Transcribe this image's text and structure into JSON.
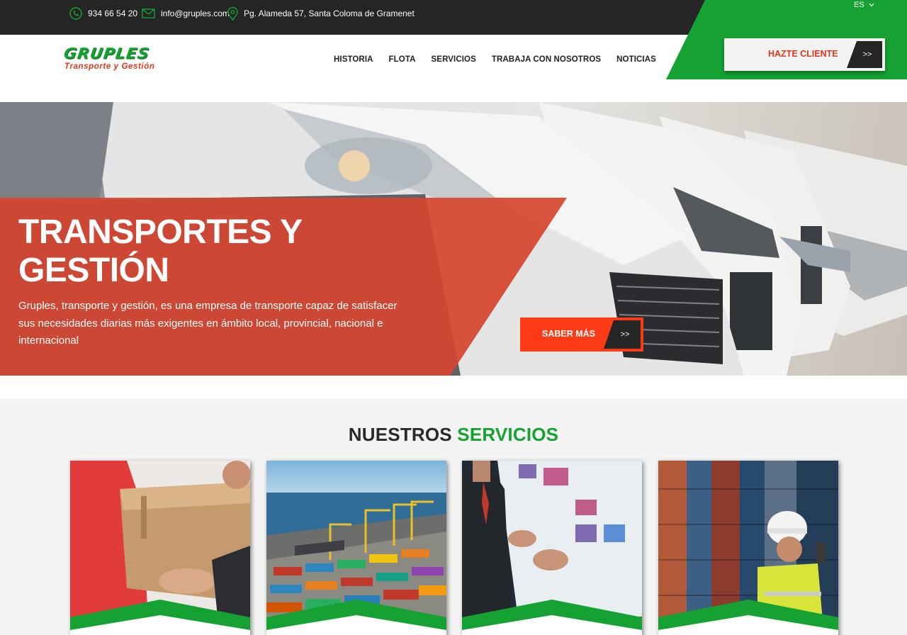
{
  "topbar": {
    "phone": "934 66 54 20",
    "email": "info@gruples.com",
    "address": "Pg. Alameda 57, Santa Coloma de Gramenet",
    "language": "ES"
  },
  "brand": {
    "name": "GRUPLES",
    "tagline": "Transporte y Gestión"
  },
  "nav": {
    "items": [
      "HISTORIA",
      "FLOTA",
      "SERVICIOS",
      "TRABAJA CON NOSOTROS",
      "NOTICIAS"
    ]
  },
  "cta": {
    "label": "HAZTE CLIENTE",
    "arrow": ">>"
  },
  "hero": {
    "title_line1": "TRANSPORTES Y",
    "title_line2": "GESTIÓN",
    "description": "Gruples, transporte y gestión, es una empresa de transporte capaz de satisfacer sus necesidades diarias más exigentes en ámbito local, provincial, nacional e internacional",
    "button_label": "SABER MÁS",
    "button_arrow": ">>"
  },
  "services": {
    "title_part1": "NUESTROS",
    "title_part2": "SERVICIOS",
    "cards": [
      {
        "icon": "parcel-delivery-photo"
      },
      {
        "icon": "port-containers-photo"
      },
      {
        "icon": "business-presentation-photo"
      },
      {
        "icon": "warehouse-worker-photo"
      }
    ]
  },
  "colors": {
    "green": "#16a232",
    "red": "#e2351b",
    "orange_button": "#ff3b17",
    "dark": "#252525"
  }
}
